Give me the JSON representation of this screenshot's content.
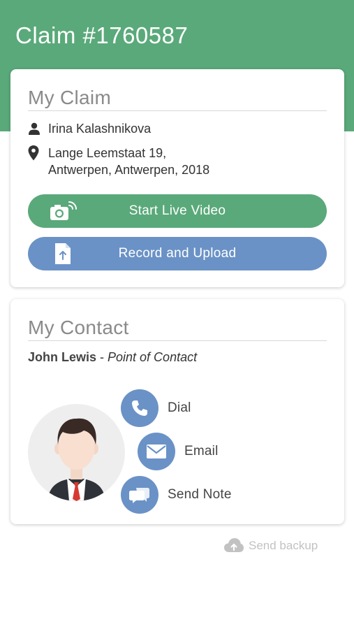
{
  "header": {
    "title": "Claim #1760587"
  },
  "claim_card": {
    "title": "My Claim",
    "claimant_name": "Irina Kalashnikova",
    "address_line1": "Lange Leemstaat 19,",
    "address_line2": "Antwerpen, Antwerpen, 2018",
    "live_video_label": "Start Live Video",
    "record_upload_label": "Record and Upload"
  },
  "contact_card": {
    "title": "My Contact",
    "contact_name": "John Lewis",
    "separator": " - ",
    "contact_role": "Point of Contact",
    "actions": [
      {
        "label": "Dial",
        "icon": "phone-icon"
      },
      {
        "label": "Email",
        "icon": "envelope-icon"
      },
      {
        "label": "Send Note",
        "icon": "chat-icon"
      }
    ]
  },
  "footer": {
    "send_backup_label": "Send backup",
    "icon": "cloud-upload-icon"
  },
  "colors": {
    "brand_green": "#5aa97a",
    "accent_blue": "#6a92c6",
    "muted_gray": "#c2c2c2"
  }
}
